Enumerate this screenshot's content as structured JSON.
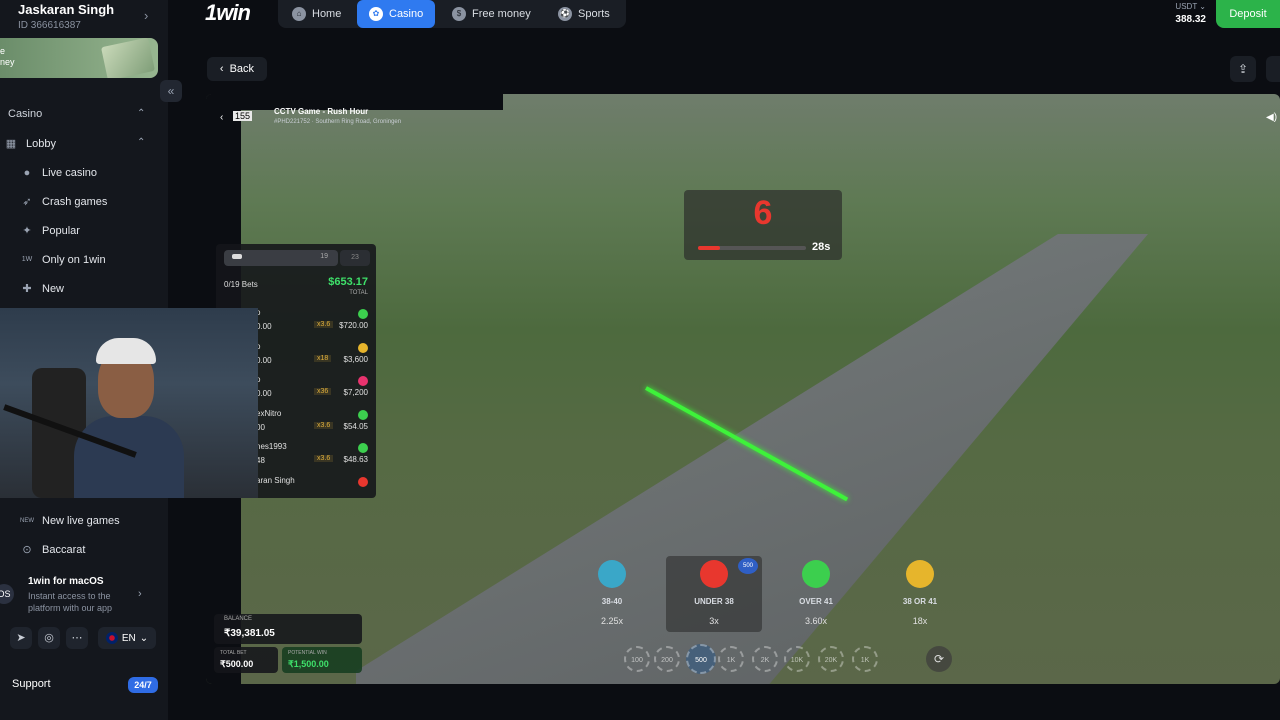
{
  "user": {
    "name": "Jaskaran Singh",
    "id": "ID 366616387"
  },
  "promo": {
    "text_line1": "e",
    "text_line2": "ney"
  },
  "sidebar": {
    "section": "Casino",
    "lobby": "Lobby",
    "items": [
      {
        "label": "Live casino",
        "icon": "live-icon"
      },
      {
        "label": "Crash games",
        "icon": "rocket-icon"
      },
      {
        "label": "Popular",
        "icon": "star-icon"
      },
      {
        "label": "Only on 1win",
        "icon": "1win-icon"
      },
      {
        "label": "New",
        "icon": "new-icon"
      },
      {
        "label": "New live games",
        "icon": "new-live-icon"
      },
      {
        "label": "Baccarat",
        "icon": "baccarat-icon"
      }
    ],
    "macos": {
      "title": "1win for macOS",
      "subtitle": "Instant access to the platform with our app"
    },
    "lang": "EN",
    "support": "Support",
    "support_badge": "24/7"
  },
  "header": {
    "logo": "1win",
    "tabs": [
      {
        "label": "Home",
        "icon": "home-icon"
      },
      {
        "label": "Casino",
        "icon": "casino-icon",
        "active": true
      },
      {
        "label": "Free money",
        "icon": "dollar-icon"
      },
      {
        "label": "Sports",
        "icon": "ball-icon"
      }
    ],
    "currency": "USDT",
    "balance": "388.32",
    "deposit": "Deposit",
    "back": "Back"
  },
  "game": {
    "title": "CCTV Game - Rush Hour",
    "subtitle": "#PHD221752 · Southern Ring Road, Groningen",
    "round_num": "155",
    "countdown": "6",
    "seconds": "28",
    "timer_progress": 0.2,
    "bets_toggle_count": "19",
    "bets_right_count": "23",
    "bets_count": "0/19 Bets",
    "total": "$653.17",
    "total_label": "TOTAL",
    "bets": [
      {
        "name": "o",
        "amount": "0.00",
        "mult": "x3.6",
        "win": "$720.00",
        "color": "#3ccf4e"
      },
      {
        "name": "o",
        "amount": "0.00",
        "mult": "x18",
        "win": "$3,600",
        "color": "#e6b52c"
      },
      {
        "name": "o",
        "amount": "0.00",
        "mult": "x36",
        "win": "$7,200",
        "color": "#e8336e"
      },
      {
        "name": "exNitro",
        "amount": "00",
        "mult": "x3.6",
        "win": "$54.05",
        "color": "#3ccf4e"
      },
      {
        "name": "nes1993",
        "amount": "48",
        "mult": "x3.6",
        "win": "$48.63",
        "color": "#3ccf4e"
      },
      {
        "name": "aran Singh",
        "amount": "",
        "mult": "",
        "win": "",
        "color": "#e8372e"
      }
    ],
    "balance_label": "BALANCE",
    "balance_value": "₹39,381.05",
    "total_bet_label": "TOTAL BET",
    "total_bet_value": "₹500.00",
    "potential_win_label": "POTENTIAL WIN",
    "potential_win_value": "₹1,500.00",
    "options": [
      {
        "label": "38-40",
        "mult": "2.25x",
        "color": "#3aa7c8"
      },
      {
        "label": "UNDER 38",
        "mult": "3x",
        "color": "#e8372e",
        "badge": "500"
      },
      {
        "label": "OVER 41",
        "mult": "3.60x",
        "color": "#3ccf4e"
      },
      {
        "label": "38 OR 41",
        "mult": "18x",
        "color": "#e6b52c"
      }
    ],
    "chips": [
      "100",
      "200",
      "500",
      "1K",
      "2K",
      "10K",
      "20K",
      "1K"
    ]
  }
}
